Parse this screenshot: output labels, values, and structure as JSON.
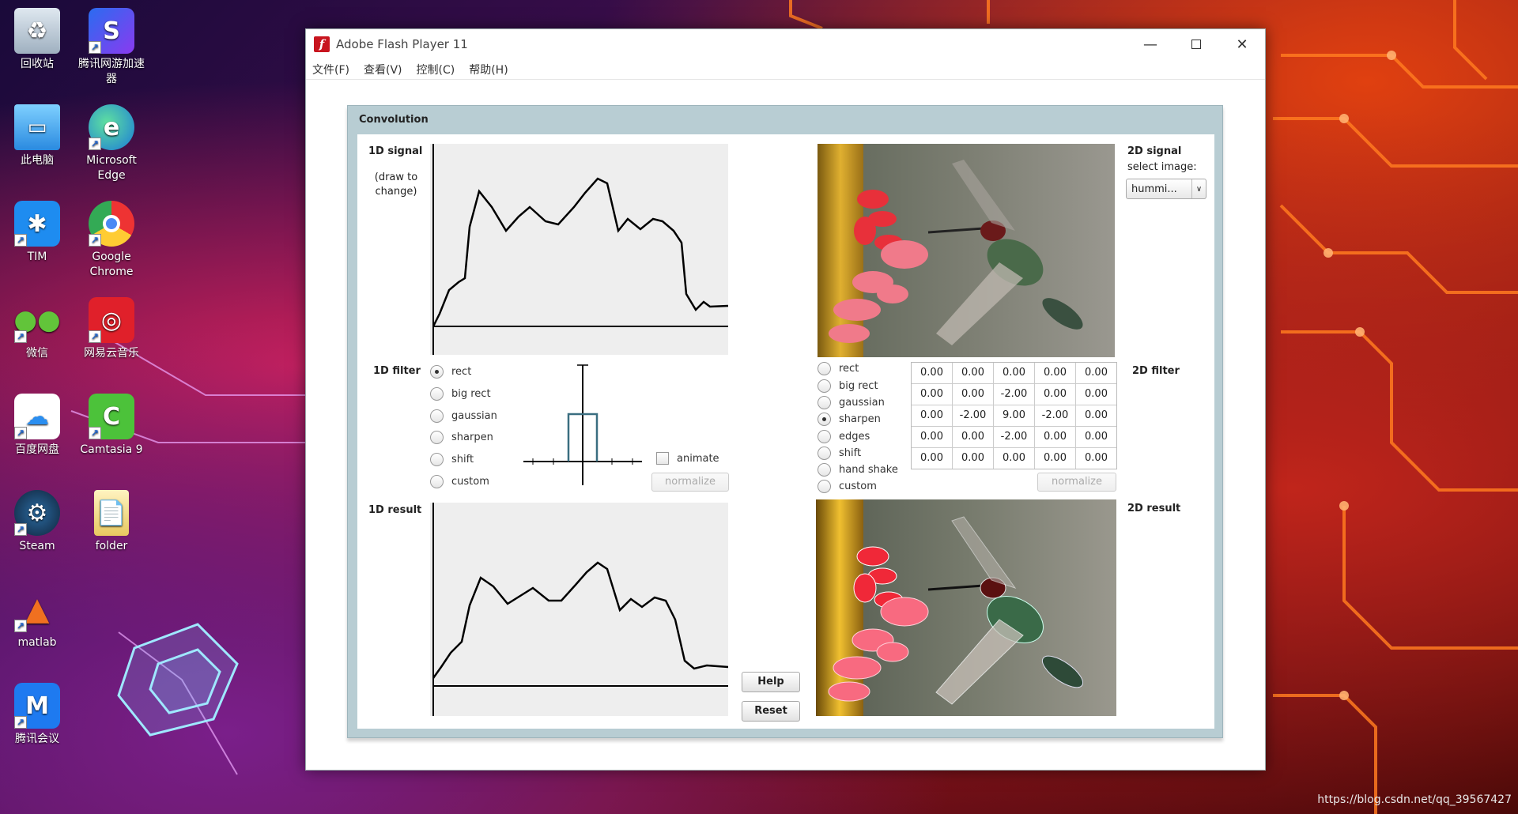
{
  "desktop": {
    "icons": [
      {
        "label": "回收站",
        "icon": "recycle-bin-icon"
      },
      {
        "label": "腾讯网游加速器",
        "icon": "game-accelerator-icon"
      },
      {
        "label": "此电脑",
        "icon": "computer-icon"
      },
      {
        "label": "Microsoft Edge",
        "icon": "edge-icon"
      },
      {
        "label": "TIM",
        "icon": "tim-icon"
      },
      {
        "label": "Google Chrome",
        "icon": "chrome-icon"
      },
      {
        "label": "微信",
        "icon": "wechat-icon"
      },
      {
        "label": "网易云音乐",
        "icon": "netease-music-icon"
      },
      {
        "label": "百度网盘",
        "icon": "baidu-netdisk-icon"
      },
      {
        "label": "Camtasia 9",
        "icon": "camtasia-icon"
      },
      {
        "label": "Steam",
        "icon": "steam-icon"
      },
      {
        "label": "folder",
        "icon": "folder-icon"
      },
      {
        "label": "matlab",
        "icon": "matlab-icon"
      },
      {
        "label": "腾讯会议",
        "icon": "tencent-meeting-icon"
      }
    ],
    "watermark": "https://blog.csdn.net/qq_39567427"
  },
  "window": {
    "title": "Adobe Flash Player 11",
    "menu": [
      "文件(F)",
      "查看(V)",
      "控制(C)",
      "帮助(H)"
    ]
  },
  "app": {
    "panel_title": "Convolution",
    "signal_1d": {
      "label": "1D signal",
      "hint": "(draw to change)"
    },
    "filter_1d": {
      "label": "1D filter",
      "options": [
        "rect",
        "big rect",
        "gaussian",
        "sharpen",
        "shift",
        "custom"
      ],
      "selected": "rect",
      "animate_label": "animate",
      "animate_checked": false,
      "normalize_label": "normalize"
    },
    "result_1d": {
      "label": "1D result"
    },
    "signal_2d": {
      "label": "2D signal",
      "select_label": "select image:",
      "selected_image": "hummi..."
    },
    "filter_2d": {
      "label": "2D filter",
      "options": [
        "rect",
        "big rect",
        "gaussian",
        "sharpen",
        "edges",
        "shift",
        "hand shake",
        "custom"
      ],
      "selected": "sharpen",
      "matrix": [
        [
          "0.00",
          "0.00",
          "0.00",
          "0.00",
          "0.00"
        ],
        [
          "0.00",
          "0.00",
          "-2.00",
          "0.00",
          "0.00"
        ],
        [
          "0.00",
          "-2.00",
          "9.00",
          "-2.00",
          "0.00"
        ],
        [
          "0.00",
          "0.00",
          "-2.00",
          "0.00",
          "0.00"
        ],
        [
          "0.00",
          "0.00",
          "0.00",
          "0.00",
          "0.00"
        ]
      ],
      "normalize_label": "normalize"
    },
    "result_2d": {
      "label": "2D result"
    },
    "help_label": "Help",
    "reset_label": "Reset"
  },
  "colors": {
    "panel_bg": "#b8cdd3",
    "plot_bg": "#eeeeee",
    "flash_red": "#c8141e"
  }
}
